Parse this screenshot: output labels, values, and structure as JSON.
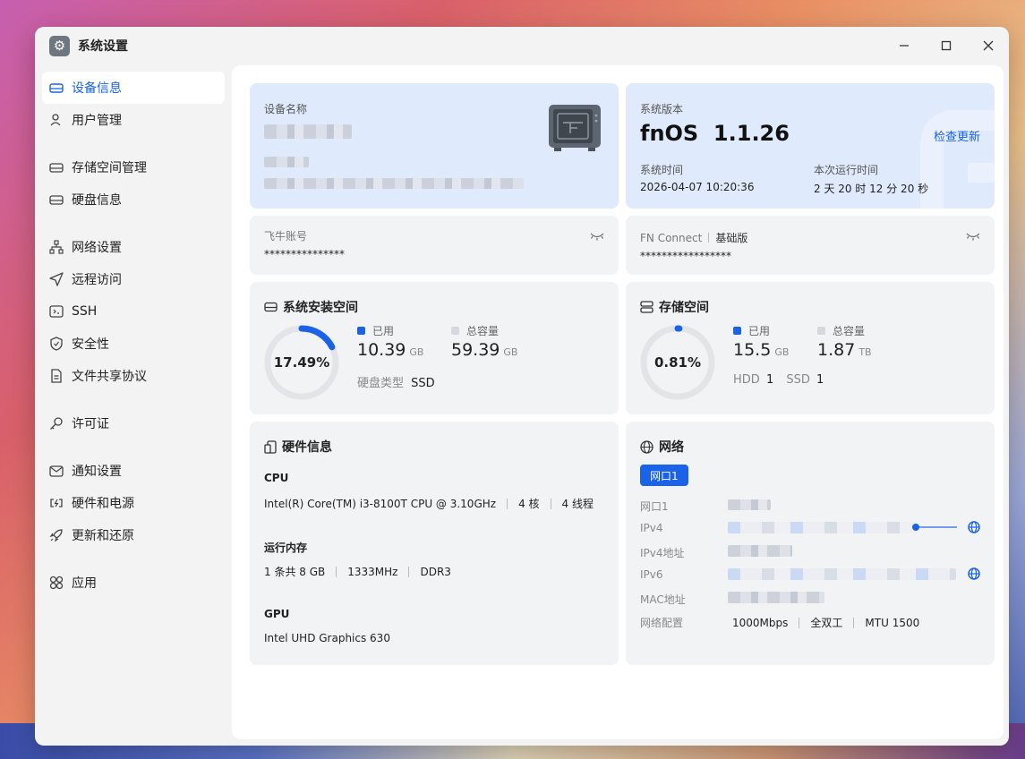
{
  "window": {
    "title": "系统设置"
  },
  "sidebar": {
    "items": [
      {
        "label": "设备信息",
        "icon": "device-icon"
      },
      {
        "label": "用户管理",
        "icon": "user-icon"
      },
      {
        "label": "存储空间管理",
        "icon": "storage-icon"
      },
      {
        "label": "硬盘信息",
        "icon": "disk-icon"
      },
      {
        "label": "网络设置",
        "icon": "network-icon"
      },
      {
        "label": "远程访问",
        "icon": "send-icon"
      },
      {
        "label": "SSH",
        "icon": "terminal-icon"
      },
      {
        "label": "安全性",
        "icon": "shield-icon"
      },
      {
        "label": "文件共享协议",
        "icon": "file-icon"
      },
      {
        "label": "许可证",
        "icon": "key-icon"
      },
      {
        "label": "通知设置",
        "icon": "mail-icon"
      },
      {
        "label": "硬件和电源",
        "icon": "power-icon"
      },
      {
        "label": "更新和还原",
        "icon": "rocket-icon"
      },
      {
        "label": "应用",
        "icon": "apps-icon"
      }
    ]
  },
  "device": {
    "name_label": "设备名称"
  },
  "system": {
    "version_label": "系统版本",
    "version": "fnOS  1.1.26",
    "check_update": "检查更新",
    "time_label": "系统时间",
    "time": "2026-04-07 10:20:36",
    "uptime_label": "本次运行时间",
    "uptime": "2 天 20 时 12 分 20 秒"
  },
  "account": {
    "label": "飞牛账号",
    "value": "***************"
  },
  "fnconnect": {
    "label": "FN Connect",
    "tier": "基础版",
    "value": "*****************"
  },
  "sys_storage": {
    "title": "系统安装空间",
    "percent_text": "17.49%",
    "percent": 0.1749,
    "used_label": "已用",
    "used_value": "10.39",
    "used_unit": "GB",
    "total_label": "总容量",
    "total_value": "59.39",
    "total_unit": "GB",
    "disk_type_label": "硬盘类型",
    "disk_type": "SSD"
  },
  "storage": {
    "title": "存储空间",
    "percent_text": "0.81%",
    "percent": 0.0081,
    "used_label": "已用",
    "used_value": "15.5",
    "used_unit": "GB",
    "total_label": "总容量",
    "total_value": "1.87",
    "total_unit": "TB",
    "hdd_label": "HDD",
    "hdd_count": "1",
    "ssd_label": "SSD",
    "ssd_count": "1"
  },
  "hardware": {
    "title": "硬件信息",
    "cpu_label": "CPU",
    "cpu_model": "Intel(R) Core(TM) i3-8100T CPU @ 3.10GHz",
    "cpu_cores": "4 核",
    "cpu_threads": "4 线程",
    "mem_label": "运行内存",
    "mem_count": "1 条共 8 GB",
    "mem_freq": "1333MHz",
    "mem_type": "DDR3",
    "gpu_label": "GPU",
    "gpu_model": "Intel UHD Graphics 630"
  },
  "network": {
    "title": "网络",
    "tab": "网口1",
    "rows": [
      "网口1",
      "IPv4",
      "IPv4地址",
      "IPv6",
      "MAC地址",
      "网络配置"
    ],
    "speed": "1000Mbps",
    "duplex": "全双工",
    "mtu": "MTU 1500"
  },
  "colors": {
    "accent": "#1a62e8",
    "ring_track": "#e3e4e8"
  }
}
